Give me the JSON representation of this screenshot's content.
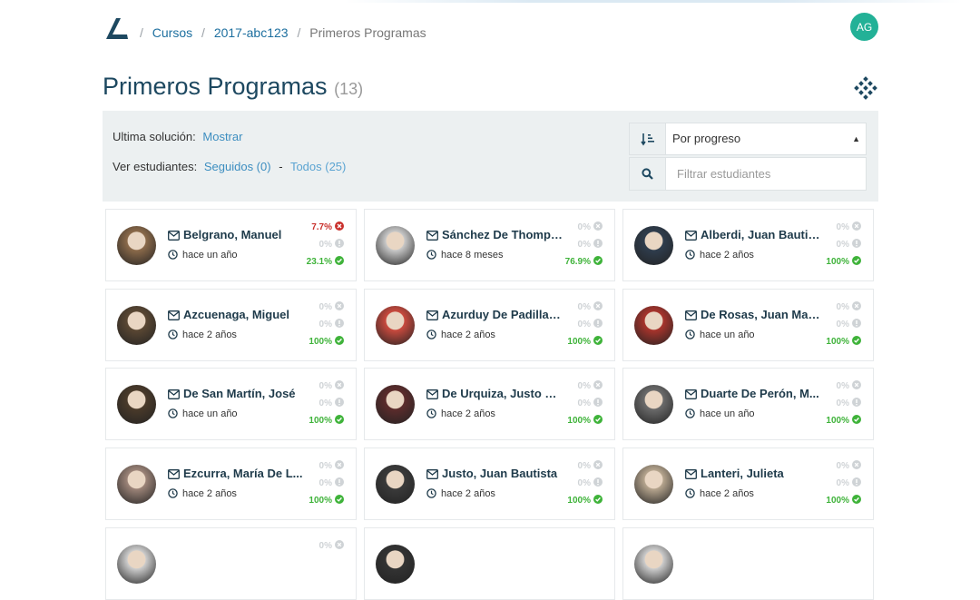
{
  "header": {
    "breadcrumb": [
      "Cursos",
      "2017-abc123",
      "Primeros Programas"
    ],
    "user_initials": "AG",
    "avatar_color": "#23b197"
  },
  "page": {
    "title": "Primeros Programas",
    "count": "(13)"
  },
  "filters": {
    "last_solution_label": "Ultima solución:",
    "last_solution_link": "Mostrar",
    "students_label": "Ver estudiantes:",
    "followed_link": "Seguidos (0)",
    "separator": "-",
    "all_link": "Todos (25)",
    "sort_value": "Por progreso",
    "search_placeholder": "Filtrar estudiantes"
  },
  "colors": {
    "accent": "#1d6f9f",
    "panel": "#ecf0f1",
    "success": "#3fb33a",
    "failure": "#c9302c",
    "neutral": "#cfd3d6"
  },
  "students": [
    {
      "name": "Belgrano, Manuel",
      "time": "hace un año",
      "stats": [
        {
          "value": "7.7%",
          "state": "failed"
        },
        {
          "value": "0%",
          "state": "pending"
        },
        {
          "value": "23.1%",
          "state": "passed"
        }
      ],
      "photo": "#8b6a4a"
    },
    {
      "name": "Sánchez De Thomps...",
      "time": "hace 8 meses",
      "stats": [
        {
          "value": "0%",
          "state": "none"
        },
        {
          "value": "0%",
          "state": "pending"
        },
        {
          "value": "76.9%",
          "state": "passed"
        }
      ],
      "photo": "#c8c8c8"
    },
    {
      "name": "Alberdi, Juan Bautista",
      "time": "hace 2 años",
      "stats": [
        {
          "value": "0%",
          "state": "none"
        },
        {
          "value": "0%",
          "state": "pending"
        },
        {
          "value": "100%",
          "state": "passed"
        }
      ],
      "photo": "#2f3d4d"
    },
    {
      "name": "Azcuenaga, Miguel",
      "time": "hace 2 años",
      "stats": [
        {
          "value": "0%",
          "state": "none"
        },
        {
          "value": "0%",
          "state": "pending"
        },
        {
          "value": "100%",
          "state": "passed"
        }
      ],
      "photo": "#5a4733"
    },
    {
      "name": "Azurduy De Padilla, ...",
      "time": "hace 2 años",
      "stats": [
        {
          "value": "0%",
          "state": "none"
        },
        {
          "value": "0%",
          "state": "pending"
        },
        {
          "value": "100%",
          "state": "passed"
        }
      ],
      "photo": "#c94a3e"
    },
    {
      "name": "De Rosas, Juan Man...",
      "time": "hace un año",
      "stats": [
        {
          "value": "0%",
          "state": "none"
        },
        {
          "value": "0%",
          "state": "pending"
        },
        {
          "value": "100%",
          "state": "passed"
        }
      ],
      "photo": "#a8342c"
    },
    {
      "name": "De San Martín, José",
      "time": "hace un año",
      "stats": [
        {
          "value": "0%",
          "state": "none"
        },
        {
          "value": "0%",
          "state": "pending"
        },
        {
          "value": "100%",
          "state": "passed"
        }
      ],
      "photo": "#4a3a2a"
    },
    {
      "name": "De Urquiza, Justo Jo...",
      "time": "hace 2 años",
      "stats": [
        {
          "value": "0%",
          "state": "none"
        },
        {
          "value": "0%",
          "state": "pending"
        },
        {
          "value": "100%",
          "state": "passed"
        }
      ],
      "photo": "#5c2c2c"
    },
    {
      "name": "Duarte De Perón, M...",
      "time": "hace un año",
      "stats": [
        {
          "value": "0%",
          "state": "none"
        },
        {
          "value": "0%",
          "state": "pending"
        },
        {
          "value": "100%",
          "state": "passed"
        }
      ],
      "photo": "#6b6b6b"
    },
    {
      "name": "Ezcurra, María De L...",
      "time": "hace 2 años",
      "stats": [
        {
          "value": "0%",
          "state": "none"
        },
        {
          "value": "0%",
          "state": "pending"
        },
        {
          "value": "100%",
          "state": "passed"
        }
      ],
      "photo": "#9c8478"
    },
    {
      "name": "Justo, Juan Bautista",
      "time": "hace 2 años",
      "stats": [
        {
          "value": "0%",
          "state": "none"
        },
        {
          "value": "0%",
          "state": "pending"
        },
        {
          "value": "100%",
          "state": "passed"
        }
      ],
      "photo": "#3a3a3a"
    },
    {
      "name": "Lanteri, Julieta",
      "time": "hace 2 años",
      "stats": [
        {
          "value": "0%",
          "state": "none"
        },
        {
          "value": "0%",
          "state": "pending"
        },
        {
          "value": "100%",
          "state": "passed"
        }
      ],
      "photo": "#b6a58e"
    },
    {
      "name": "",
      "time": "",
      "stats": [
        {
          "value": "0%",
          "state": "none"
        }
      ],
      "photo": "#cccccc"
    },
    {
      "name": "",
      "time": "",
      "stats": [],
      "photo": "#333333"
    },
    {
      "name": "",
      "time": "",
      "stats": [],
      "photo": "#cccccc"
    }
  ]
}
